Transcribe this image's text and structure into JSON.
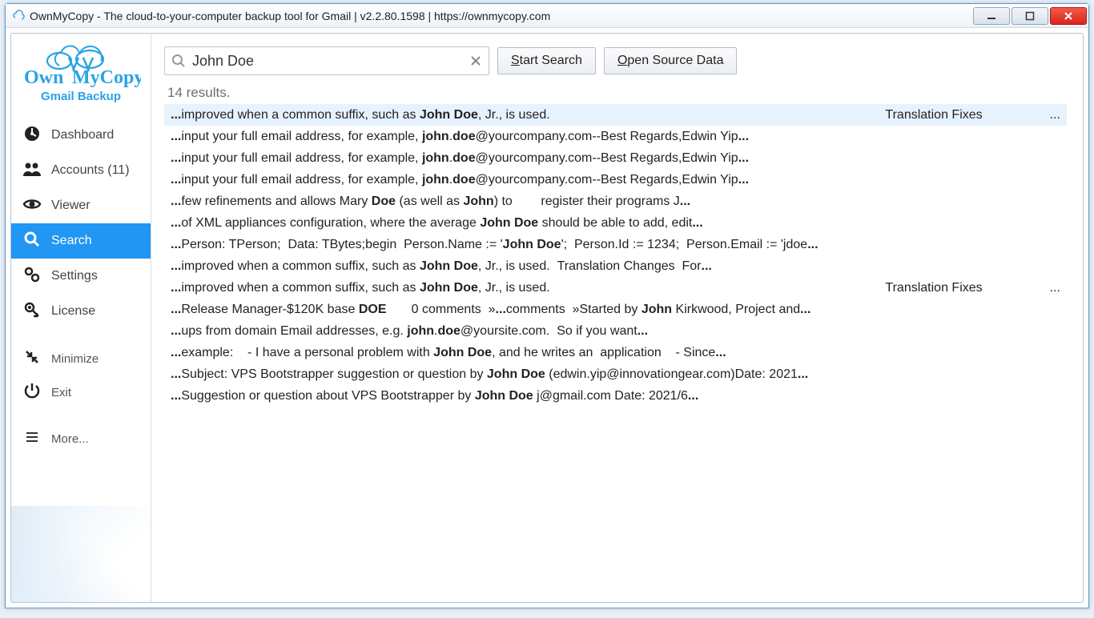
{
  "window": {
    "title": "OwnMyCopy - The cloud-to-your-computer backup tool for Gmail  |  v2.2.80.1598  |  https://ownmycopy.com"
  },
  "logo": {
    "line1_left": "Own",
    "line1_right": "MyCopy",
    "line2": "Gmail Backup"
  },
  "sidebar": {
    "items": [
      {
        "key": "dashboard",
        "label": "Dashboard",
        "icon": "dashboard"
      },
      {
        "key": "accounts",
        "label": "Accounts (11)",
        "icon": "accounts"
      },
      {
        "key": "viewer",
        "label": "Viewer",
        "icon": "viewer"
      },
      {
        "key": "search",
        "label": "Search",
        "icon": "search",
        "active": true
      },
      {
        "key": "settings",
        "label": "Settings",
        "icon": "settings"
      },
      {
        "key": "license",
        "label": "License",
        "icon": "license"
      }
    ],
    "secondary": [
      {
        "key": "minimize",
        "label": "Minimize",
        "icon": "minimize"
      },
      {
        "key": "exit",
        "label": "Exit",
        "icon": "exit"
      }
    ],
    "more": {
      "label": "More..."
    }
  },
  "search": {
    "value": "John Doe",
    "start_label_pre": "S",
    "start_label_rest": "tart Search",
    "open_label_pre": "O",
    "open_label_rest": "pen Source Data"
  },
  "results": {
    "count_text": "14 results.",
    "rows": [
      {
        "selected": true,
        "col1": "<b>...</b>improved when a common suffix, such as <b>John Doe</b>, Jr., is used.",
        "col2": "Translation Fixes",
        "col3": "..."
      },
      {
        "col1": "<b>...</b>input your full email address, for example, <b>john</b>.<b>doe</b>@yourcompany.com--Best Regards,Edwin Yip<b>...</b>"
      },
      {
        "col1": "<b>...</b>input your full email address, for example, <b>john</b>.<b>doe</b>@yourcompany.com--Best Regards,Edwin Yip<b>...</b>"
      },
      {
        "col1": "<b>...</b>input your full email address, for example, <b>john</b>.<b>doe</b>@yourcompany.com--Best Regards,Edwin Yip<b>...</b>"
      },
      {
        "col1": "<b>...</b>few refinements and allows Mary <b>Doe</b> (as well as <b>John</b>) to &nbsp;&nbsp;&nbsp;&nbsp;&nbsp;&nbsp;&nbsp;register their programs J<b>...</b>"
      },
      {
        "col1": "<b>...</b>of XML appliances configuration, where the average <b>John Doe</b> should be able to add, edit<b>...</b>"
      },
      {
        "col1": "<b>...</b>Person: TPerson;&nbsp;&nbsp;Data: TBytes;begin&nbsp;&nbsp;Person.Name := '<b>John Doe</b>';&nbsp;&nbsp;Person.Id := 1234;&nbsp;&nbsp;Person.Email := 'jdoe<b>...</b>"
      },
      {
        "col1": "<b>...</b>improved when a common suffix, such as <b>John Doe</b>, Jr., is used.&nbsp;&nbsp;Translation Changes&nbsp;&nbsp;For<b>...</b>"
      },
      {
        "col1": "<b>...</b>improved when a common suffix, such as <b>John Doe</b>, Jr., is used.",
        "col2": "Translation Fixes",
        "col3": "..."
      },
      {
        "col1": "<b>...</b>Release Manager-$120K base <b>DOE</b>&nbsp;&nbsp;&nbsp;&nbsp;&nbsp;&nbsp;&nbsp;0 comments&nbsp;&nbsp;»<b>...</b>comments&nbsp;&nbsp;»Started by <b>John</b> Kirkwood, Project and<b>...</b>"
      },
      {
        "col1": "<b>...</b>ups from domain Email addresses, e.g. <b>john</b>.<b>doe</b>@yoursite.com.&nbsp;&nbsp;So if you want<b>...</b>"
      },
      {
        "col1": "<b>...</b>example:&nbsp;&nbsp;&nbsp;&nbsp;- I have a personal problem with <b>John Doe</b>, and he writes an&nbsp;&nbsp;application&nbsp;&nbsp;&nbsp;&nbsp;- Since<b>...</b>"
      },
      {
        "col1": "<b>...</b>Subject: VPS Bootstrapper suggestion or question by <b>John Doe</b> (edwin.yip@innovationgear.com)Date: 2021<b>...</b>"
      },
      {
        "col1": "<b>...</b>Suggestion or question about VPS Bootstrapper by <b>John Doe</b> j@gmail.com Date: 2021/6<b>...</b>"
      }
    ]
  }
}
